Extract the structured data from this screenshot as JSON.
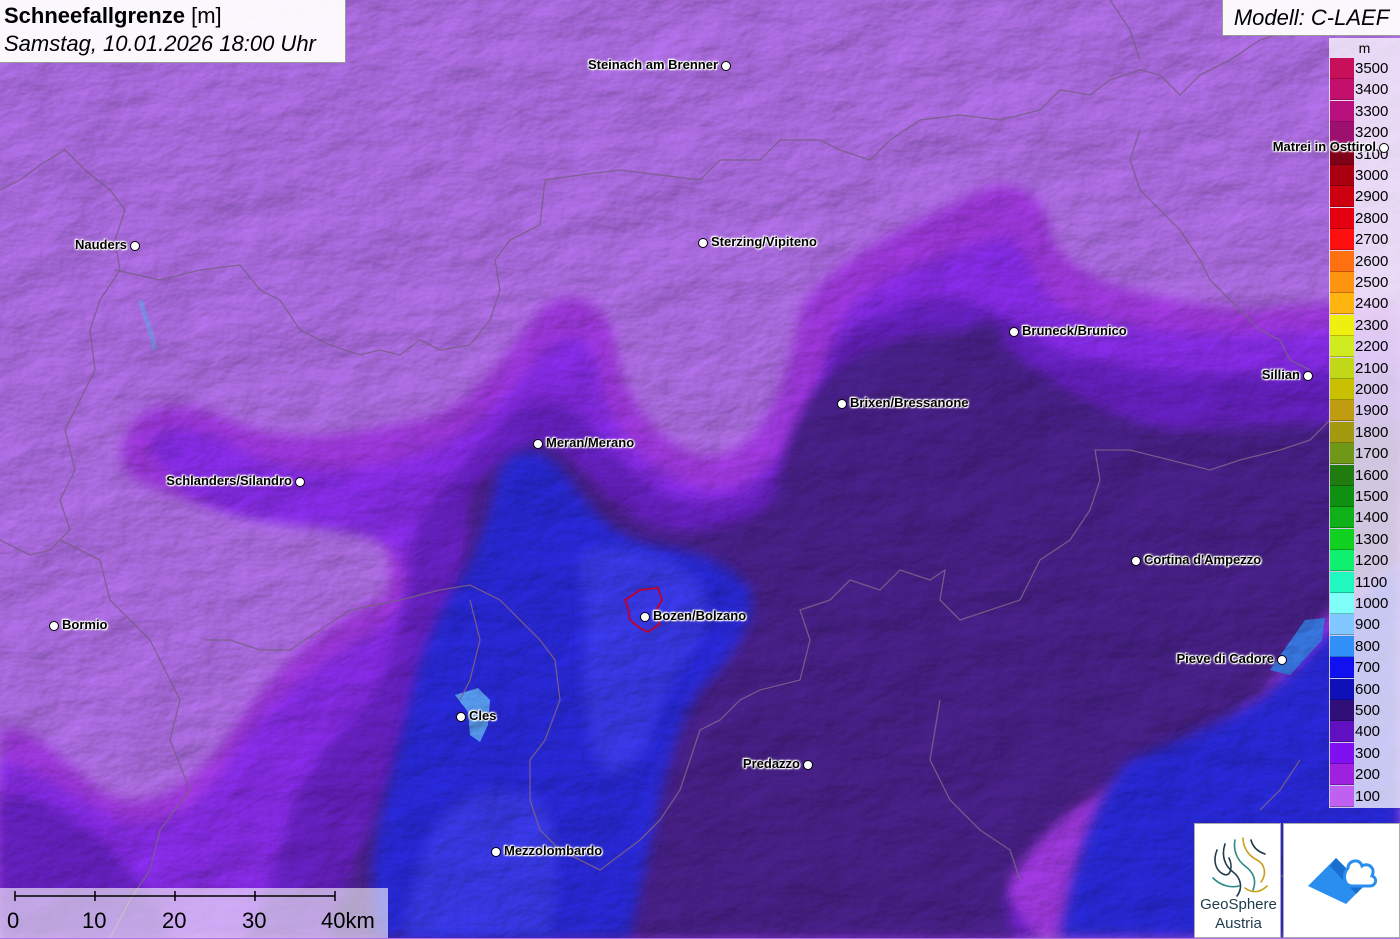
{
  "title": {
    "name": "Schneefallgrenze",
    "unit": "[m]",
    "datetime": "Samstag, 10.01.2026 18:00 Uhr"
  },
  "model": "Modell: C-LAEF",
  "legend": {
    "unit": "m",
    "items": [
      {
        "label": "3500",
        "color": "#c8105a"
      },
      {
        "label": "3400",
        "color": "#c2106c"
      },
      {
        "label": "3300",
        "color": "#b8107c"
      },
      {
        "label": "3200",
        "color": "#9c1070"
      },
      {
        "label": "3100",
        "color": "#800018"
      },
      {
        "label": "3000",
        "color": "#a80010"
      },
      {
        "label": "2900",
        "color": "#cc0010"
      },
      {
        "label": "2800",
        "color": "#e40010"
      },
      {
        "label": "2700",
        "color": "#ff1010"
      },
      {
        "label": "2600",
        "color": "#ff7010"
      },
      {
        "label": "2500",
        "color": "#ff9410"
      },
      {
        "label": "2400",
        "color": "#ffb410"
      },
      {
        "label": "2300",
        "color": "#f0f010"
      },
      {
        "label": "2200",
        "color": "#d0ec20"
      },
      {
        "label": "2100",
        "color": "#c0d818"
      },
      {
        "label": "2000",
        "color": "#c8c000"
      },
      {
        "label": "1900",
        "color": "#c09c10"
      },
      {
        "label": "1800",
        "color": "#a49a10"
      },
      {
        "label": "1700",
        "color": "#709818"
      },
      {
        "label": "1600",
        "color": "#207c10"
      },
      {
        "label": "1500",
        "color": "#109010"
      },
      {
        "label": "1400",
        "color": "#10b018"
      },
      {
        "label": "1300",
        "color": "#10d020"
      },
      {
        "label": "1200",
        "color": "#10f070"
      },
      {
        "label": "1100",
        "color": "#20f8c0"
      },
      {
        "label": "1000",
        "color": "#80fff8"
      },
      {
        "label": "900",
        "color": "#80c8ff"
      },
      {
        "label": "800",
        "color": "#3090f8"
      },
      {
        "label": "700",
        "color": "#1010f0"
      },
      {
        "label": "600",
        "color": "#1010b8"
      },
      {
        "label": "500",
        "color": "#301078"
      },
      {
        "label": "400",
        "color": "#6010c0"
      },
      {
        "label": "300",
        "color": "#8010f0"
      },
      {
        "label": "200",
        "color": "#a020e0"
      },
      {
        "label": "100",
        "color": "#c060f0"
      }
    ]
  },
  "cities": [
    {
      "name": "Steinach am Brenner",
      "side": "left"
    },
    {
      "name": "Nauders",
      "side": "left"
    },
    {
      "name": "Sterzing/Vipiteno",
      "side": "right"
    },
    {
      "name": "Matrei in Osttirol",
      "side": "left"
    },
    {
      "name": "Bruneck/Brunico",
      "side": "right"
    },
    {
      "name": "Sillian",
      "side": "left"
    },
    {
      "name": "Brixen/Bressanone",
      "side": "right"
    },
    {
      "name": "Meran/Merano",
      "side": "right"
    },
    {
      "name": "Schlanders/Silandro",
      "side": "left"
    },
    {
      "name": "Cortina d'Ampezzo",
      "side": "right"
    },
    {
      "name": "Bormio",
      "side": "right"
    },
    {
      "name": "Bozen/Bolzano",
      "side": "right"
    },
    {
      "name": "Pieve di Cadore",
      "side": "left"
    },
    {
      "name": "Cles",
      "side": "right"
    },
    {
      "name": "Predazzo",
      "side": "left"
    },
    {
      "name": "Mezzolombardo",
      "side": "right"
    }
  ],
  "scale": {
    "ticks": [
      "0",
      "10",
      "20",
      "30",
      "40km"
    ]
  },
  "logos": {
    "geosphere_line1": "GeoSphere",
    "geosphere_line2": "Austria"
  },
  "icons": [
    "geosphere-logo-icon",
    "weather-app-logo-icon"
  ]
}
